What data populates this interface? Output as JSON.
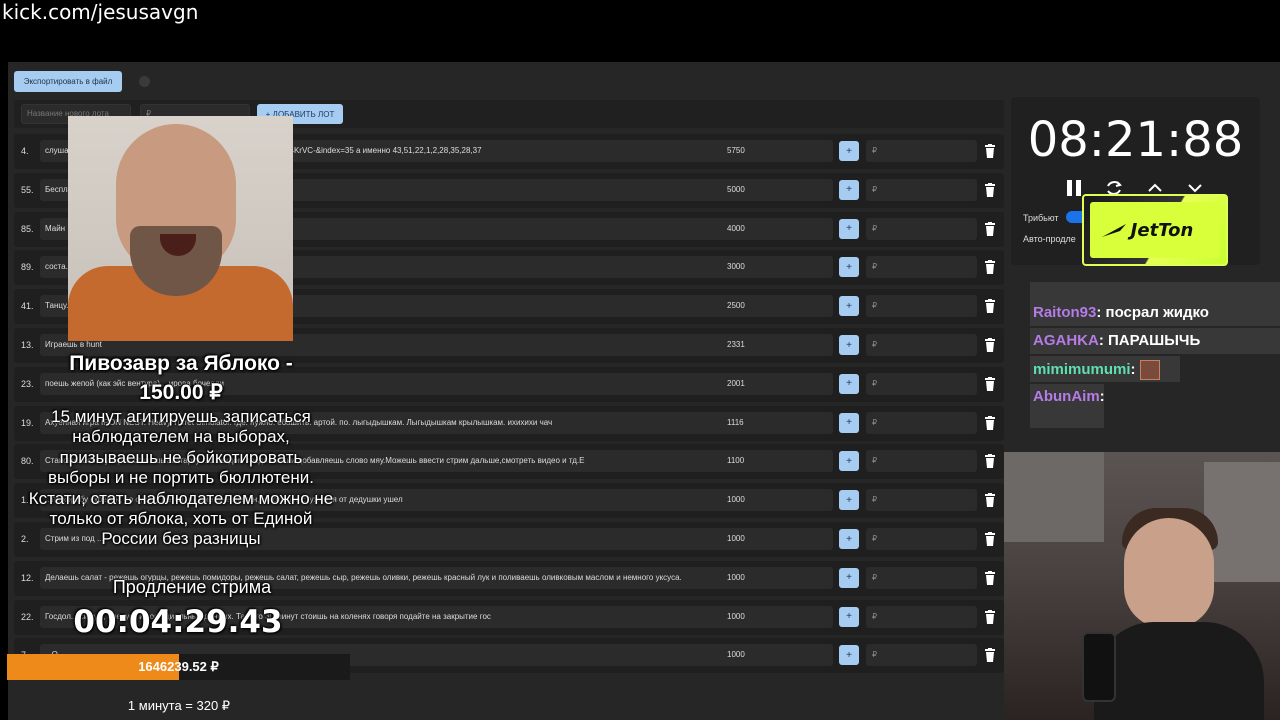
{
  "stream_url": "kick.com/jesusavgn",
  "toolbar": {
    "export_label": "Экспортировать в файл",
    "new_lot_placeholder": "Название нового лота",
    "amount_placeholder": "₽",
    "add_lot_label": "+ ДОБАВИТЬ ЛОТ"
  },
  "lots": [
    {
      "num": "4.",
      "text": "слушае...=kcw4VPDG9Lw&list=PL2oDceHo5WQ0YtkDvyplKKRTisN4KrVC-&index=35 а именно 43,51,22,1,2,28,35,28,37",
      "amount": "5750",
      "plus": "+",
      "rub": "₽"
    },
    {
      "num": "55.",
      "text": "Беспл",
      "amount": "5000",
      "plus": "+",
      "rub": "₽"
    },
    {
      "num": "85.",
      "text": "Майн",
      "amount": "4000",
      "plus": "+",
      "rub": "₽"
    },
    {
      "num": "89.",
      "text": "соста...шь вилки",
      "amount": "3000",
      "plus": "+",
      "rub": "₽"
    },
    {
      "num": "41.",
      "text": "Танцу... крылышки / какашки мне в кармашки",
      "amount": "2500",
      "plus": "+",
      "rub": "₽"
    },
    {
      "num": "13.",
      "text": "Играешь в hunt",
      "amount": "2331",
      "plus": "+",
      "rub": "₽"
    },
    {
      "num": "23.",
      "text": "поешь жепой (как эйс вентура) ...ирова бочелли",
      "amount": "2001",
      "plus": "+",
      "rub": "₽"
    },
    {
      "num": "19.",
      "text": "Ахуенная игра IRON NEST. Heavy Turret Simulator. где. нужно. ебашить. артой. по. лыгыдышкам. Лыгыдышкам крылышкам. ихихихи чач",
      "amount": "1116",
      "plus": "+",
      "rub": "₽"
    },
    {
      "num": "80.",
      "text": "Становишься ктуберов ставишь аватарку ...в каждом предложении добавляешь слово мяу.Можешь ввести стрим дальше,смотреть видео и тд.Е",
      "amount": "1100",
      "plus": "+",
      "rub": "₽"
    },
    {
      "num": "1.",
      "text": "...по коробу скребен, по сусеку метен, на сметане мешон, на окошке стужен, я от дедушки ушел",
      "amount": "1000",
      "plus": "+",
      "rub": "₽"
    },
    {
      "num": "2.",
      "text": "Стрим из под ...",
      "amount": "1000",
      "plus": "+",
      "rub": "₽"
    },
    {
      "num": "12.",
      "text": "Делаешь салат - режешь огурцы, режешь помидоры, режешь салат, режешь сыр, режешь оливки, режешь красный лук и поливаешь оливковым маслом и немного уксуса.",
      "amount": "1000",
      "plus": "+",
      "rub": "₽"
    },
    {
      "num": "22.",
      "text": "Госдол... симум, следует из официальных данных. Так что 30 минут стоишь на коленях говоря подайте на закрытие гос",
      "amount": "1000",
      "plus": "+",
      "rub": "₽"
    },
    {
      "num": "7.",
      "text": "...Q",
      "amount": "1000",
      "plus": "+",
      "rub": "₽"
    }
  ],
  "timer_panel": {
    "time": "08:21:88",
    "tribute_label": "Трибьют",
    "auto_label": "Авто-продле",
    "sponsor": "JetTon"
  },
  "chat": [
    {
      "user": "Raiton93",
      "sep": ": ",
      "msg": "посрал жидко",
      "color": "#b57be6"
    },
    {
      "user": "AGAHKA",
      "sep": ": ",
      "msg": "ПАРАШЫЧЬ",
      "color": "#b57be6"
    },
    {
      "user": "mimimumumi",
      "sep": ": ",
      "msg": "",
      "color": "#5ee0b0"
    },
    {
      "user": "АbunAim",
      "sep": ":",
      "msg": "",
      "color": "#b57be6"
    }
  ],
  "overlay": {
    "donation_title": "Пивозавр за Яблоко -",
    "donation_amount": "150.00 ₽",
    "donation_lines": [
      "15 минут агитируешь записаться",
      "наблюдателем на выборах,",
      "призываешь не бойкотировать",
      "выборы и не портить бюллютени.",
      "Кстати, стать наблюдателем можно не",
      "только от яблока, хоть от Единой",
      "России  без разницы"
    ],
    "extension_label": "Продление стрима",
    "extension_timer": "00:04:29.43",
    "progress_text": "1646239.52 ₽",
    "progress_fraction": 0.5,
    "rate_note": "1 минута = 320 ₽"
  },
  "colors": {
    "accent_button": "#a7ccf1",
    "progress": "#ee8a1a",
    "toggle": "#1a73e8",
    "jetton": "#d8ff3a"
  }
}
